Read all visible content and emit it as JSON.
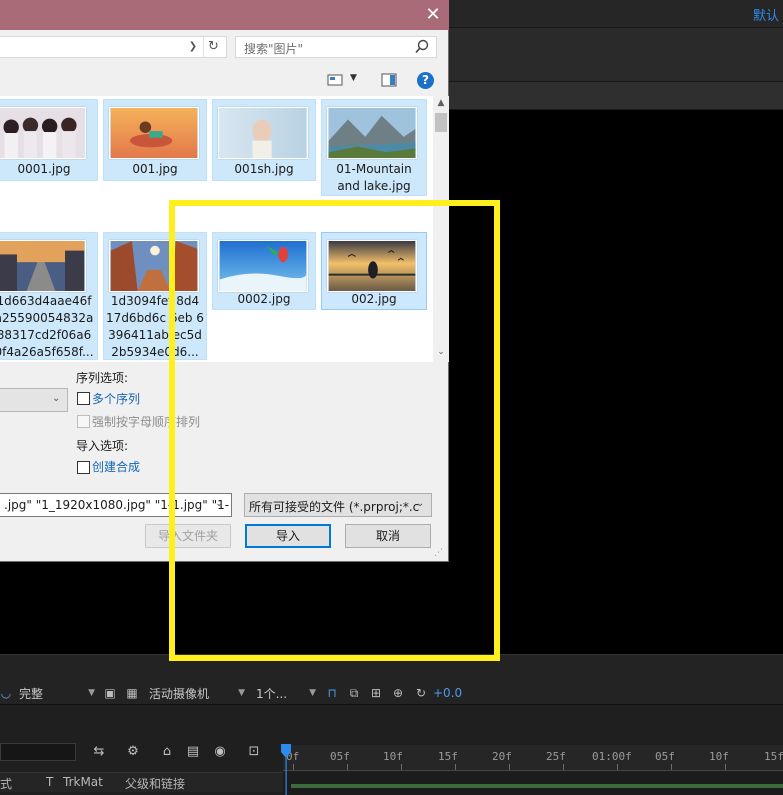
{
  "app": {
    "top_right_label": "默认",
    "viewer_controls": {
      "resolution": "完整",
      "camera": "活动摄像机",
      "views": "1个...",
      "exposure": "+0.0"
    },
    "timeline": {
      "ruler_ticks": [
        "0f",
        "05f",
        "10f",
        "15f",
        "20f",
        "25f",
        "01:00f",
        "05f",
        "10f",
        "15f"
      ],
      "columns": [
        "式",
        "T",
        "TrkMat",
        "父级和链接"
      ]
    }
  },
  "dialog": {
    "close_symbol": "✕",
    "search_placeholder": "搜索\"图片\"",
    "help_symbol": "?",
    "files_row1": [
      {
        "label": "0001.jpg"
      },
      {
        "label": "001.jpg"
      },
      {
        "label": "001sh.jpg"
      },
      {
        "label": "01-Mountain and lake.jpg"
      }
    ],
    "files_row2": [
      {
        "label": "1d663d4aae46f a25590054832a 88317cd2f06a6 0f4a26a5f658f..."
      },
      {
        "label": "1d3094fef 8d4 17d6bd6c 6eb 6396411ab ec5d 2b5934e0d6..."
      },
      {
        "label": "0002.jpg"
      },
      {
        "label": "002.jpg"
      }
    ],
    "sequence_options": {
      "heading": "序列选项:",
      "multiple_sequences": "多个序列",
      "force_alpha": "强制按字母顺序排列"
    },
    "import_options": {
      "heading": "导入选项:",
      "create_composition": "创建合成"
    },
    "filename_value": ".jpg\" \"1_1920x1080.jpg\" \"1-1.jpg\" \"1-",
    "filetype_value": "所有可接受的文件 (*.prproj;*.c",
    "buttons": {
      "import_folder": "导入文件夹",
      "import": "导入",
      "cancel": "取消"
    }
  },
  "colors": {
    "titlebar": "#a96b78",
    "highlight": "#fff01d",
    "link": "#1566b5",
    "accent_blue": "#2d8ceb"
  }
}
